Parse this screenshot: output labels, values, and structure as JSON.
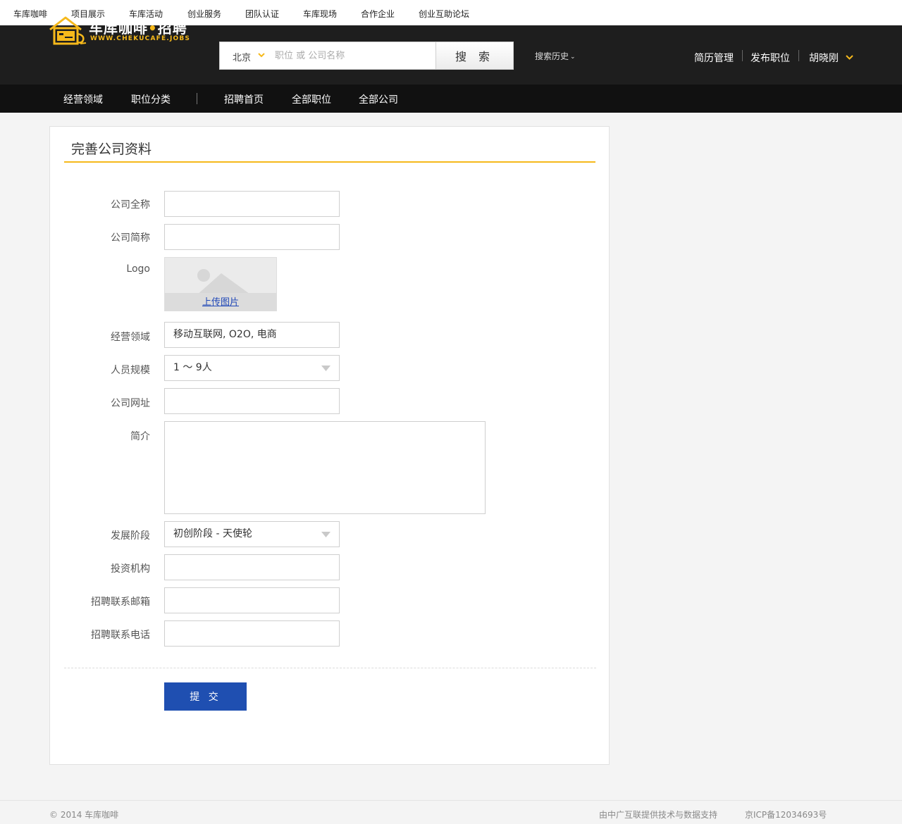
{
  "topbar": {
    "links": [
      "车库咖啡",
      "项目展示",
      "车库活动",
      "创业服务",
      "团队认证",
      "车库现场",
      "合作企业",
      "创业互助论坛"
    ]
  },
  "brand": {
    "title_main": "车库咖啡",
    "title_dot": "•",
    "title_suffix": "招聘",
    "subtitle": "WWW.CHEKUCAFE.JOBS",
    "accent_color": "#f6b91b",
    "icon": "garage-house-cup-logo"
  },
  "search": {
    "city": "北京",
    "placeholder": "职位 或 公司名称",
    "value": "",
    "button_label": "搜 索",
    "history_label": "搜索历史"
  },
  "user_menu": {
    "resume_label": "简历管理",
    "post_job_label": "发布职位",
    "username": "胡晓刚"
  },
  "nav": {
    "left": [
      "经营领域",
      "职位分类"
    ],
    "right": [
      "招聘首页",
      "全部职位",
      "全部公司"
    ]
  },
  "form": {
    "title": "完善公司资料",
    "fields": {
      "full_name": {
        "label": "公司全称",
        "value": ""
      },
      "short_name": {
        "label": "公司简称",
        "value": ""
      },
      "logo": {
        "label": "Logo",
        "upload_label": "上传图片"
      },
      "business_field": {
        "label": "经营领域",
        "value": "移动互联网, O2O, 电商"
      },
      "staff_size": {
        "label": "人员规模",
        "value": "1 ～ 9人"
      },
      "website": {
        "label": "公司网址",
        "value": ""
      },
      "intro": {
        "label": "简介",
        "value": ""
      },
      "stage": {
        "label": "发展阶段",
        "value": "初创阶段 - 天使轮"
      },
      "investors": {
        "label": "投资机构",
        "value": ""
      },
      "hr_email": {
        "label": "招聘联系邮箱",
        "value": ""
      },
      "hr_phone": {
        "label": "招聘联系电话",
        "value": ""
      }
    },
    "submit_label": "提 交",
    "submit_color": "#1f4fb1"
  },
  "footer": {
    "copyright": "© 2014 车库咖啡",
    "support": "由中广互联提供技术与数据支持",
    "icp": "京ICP备12034693号"
  }
}
